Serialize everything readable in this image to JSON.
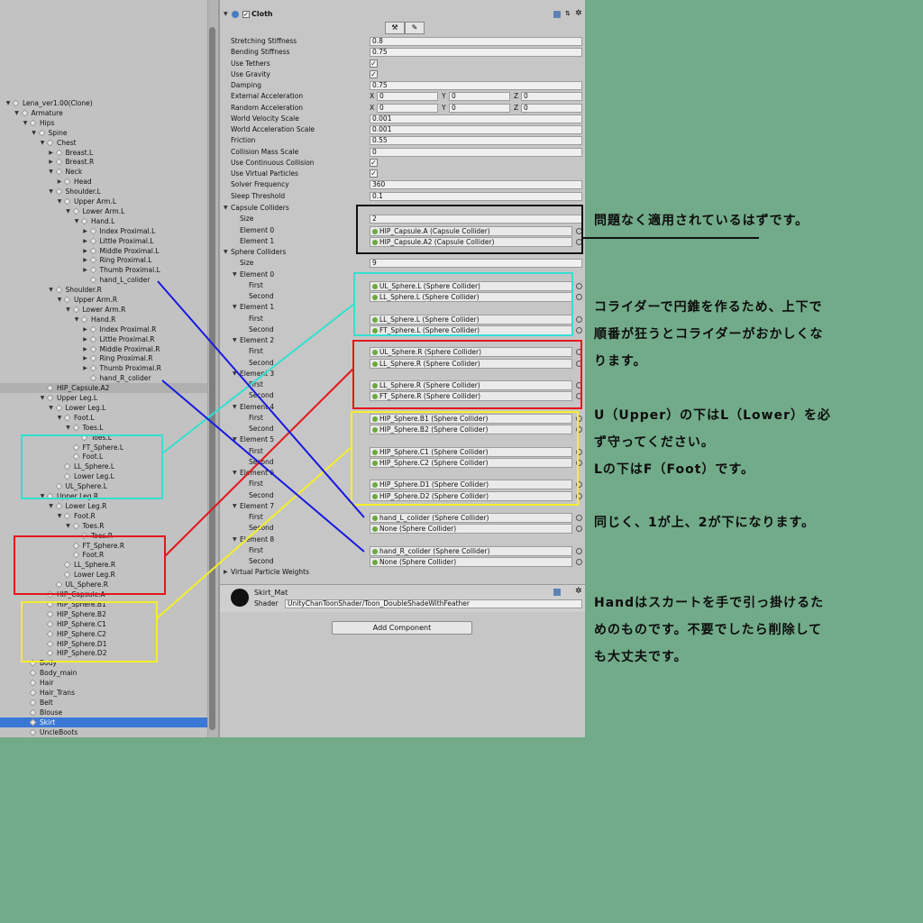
{
  "hierarchy": {
    "rows": [
      {
        "label": "Lena_ver1.00(Clone)",
        "depth": 0,
        "arrow": "down"
      },
      {
        "label": "Armature",
        "depth": 1,
        "arrow": "down"
      },
      {
        "label": "Hips",
        "depth": 2,
        "arrow": "down"
      },
      {
        "label": "Spine",
        "depth": 3,
        "arrow": "down"
      },
      {
        "label": "Chest",
        "depth": 4,
        "arrow": "down"
      },
      {
        "label": "Breast.L",
        "depth": 5,
        "arrow": "right"
      },
      {
        "label": "Breast.R",
        "depth": 5,
        "arrow": "right"
      },
      {
        "label": "Neck",
        "depth": 5,
        "arrow": "down"
      },
      {
        "label": "Head",
        "depth": 6,
        "arrow": "right"
      },
      {
        "label": "Shoulder.L",
        "depth": 5,
        "arrow": "down"
      },
      {
        "label": "Upper Arm.L",
        "depth": 6,
        "arrow": "down"
      },
      {
        "label": "Lower Arm.L",
        "depth": 7,
        "arrow": "down"
      },
      {
        "label": "Hand.L",
        "depth": 8,
        "arrow": "down"
      },
      {
        "label": "Index Proximal.L",
        "depth": 9,
        "arrow": "right"
      },
      {
        "label": "Little Proximal.L",
        "depth": 9,
        "arrow": "right"
      },
      {
        "label": "Middle Proximal.L",
        "depth": 9,
        "arrow": "right"
      },
      {
        "label": "Ring Proximal.L",
        "depth": 9,
        "arrow": "right"
      },
      {
        "label": "Thumb Proximal.L",
        "depth": 9,
        "arrow": "right"
      },
      {
        "label": "hand_L_colider",
        "depth": 9,
        "arrow": ""
      },
      {
        "label": "Shoulder.R",
        "depth": 5,
        "arrow": "down"
      },
      {
        "label": "Upper Arm.R",
        "depth": 6,
        "arrow": "down"
      },
      {
        "label": "Lower Arm.R",
        "depth": 7,
        "arrow": "down"
      },
      {
        "label": "Hand.R",
        "depth": 8,
        "arrow": "down"
      },
      {
        "label": "Index Proximal.R",
        "depth": 9,
        "arrow": "right"
      },
      {
        "label": "Little Proximal.R",
        "depth": 9,
        "arrow": "right"
      },
      {
        "label": "Middle Proximal.R",
        "depth": 9,
        "arrow": "right"
      },
      {
        "label": "Ring Proximal.R",
        "depth": 9,
        "arrow": "right"
      },
      {
        "label": "Thumb Proximal.R",
        "depth": 9,
        "arrow": "right"
      },
      {
        "label": "hand_R_colider",
        "depth": 9,
        "arrow": ""
      },
      {
        "label": "HIP_Capsule.A2",
        "depth": 4,
        "arrow": "",
        "highlight": true
      },
      {
        "label": "Upper Leg.L",
        "depth": 4,
        "arrow": "down"
      },
      {
        "label": "Lower Leg.L",
        "depth": 5,
        "arrow": "down"
      },
      {
        "label": "Foot.L",
        "depth": 6,
        "arrow": "down"
      },
      {
        "label": "Toes.L",
        "depth": 7,
        "arrow": "down"
      },
      {
        "label": "Toes.L",
        "depth": 8,
        "arrow": ""
      },
      {
        "label": "FT_Sphere.L",
        "depth": 7,
        "arrow": ""
      },
      {
        "label": "Foot.L",
        "depth": 7,
        "arrow": ""
      },
      {
        "label": "LL_Sphere.L",
        "depth": 6,
        "arrow": ""
      },
      {
        "label": "Lower Leg.L",
        "depth": 6,
        "arrow": ""
      },
      {
        "label": "UL_Sphere.L",
        "depth": 5,
        "arrow": ""
      },
      {
        "label": "Upper Leg.R",
        "depth": 4,
        "arrow": "down"
      },
      {
        "label": "Lower Leg.R",
        "depth": 5,
        "arrow": "down"
      },
      {
        "label": "Foot.R",
        "depth": 6,
        "arrow": "down"
      },
      {
        "label": "Toes.R",
        "depth": 7,
        "arrow": "down"
      },
      {
        "label": "Toes.R",
        "depth": 8,
        "arrow": ""
      },
      {
        "label": "FT_Sphere.R",
        "depth": 7,
        "arrow": ""
      },
      {
        "label": "Foot.R",
        "depth": 7,
        "arrow": ""
      },
      {
        "label": "LL_Sphere.R",
        "depth": 6,
        "arrow": ""
      },
      {
        "label": "Lower Leg.R",
        "depth": 6,
        "arrow": ""
      },
      {
        "label": "UL_Sphere.R",
        "depth": 5,
        "arrow": ""
      },
      {
        "label": "HIP_Capsule.A",
        "depth": 4,
        "arrow": ""
      },
      {
        "label": "HIP_Sphere.B1",
        "depth": 4,
        "arrow": ""
      },
      {
        "label": "HIP_Sphere.B2",
        "depth": 4,
        "arrow": ""
      },
      {
        "label": "HIP_Sphere.C1",
        "depth": 4,
        "arrow": ""
      },
      {
        "label": "HIP_Sphere.C2",
        "depth": 4,
        "arrow": ""
      },
      {
        "label": "HIP_Sphere.D1",
        "depth": 4,
        "arrow": ""
      },
      {
        "label": "HIP_Sphere.D2",
        "depth": 4,
        "arrow": ""
      },
      {
        "label": "Body",
        "depth": 2,
        "arrow": ""
      },
      {
        "label": "Body_main",
        "depth": 2,
        "arrow": ""
      },
      {
        "label": "Hair",
        "depth": 2,
        "arrow": ""
      },
      {
        "label": "Hair_Trans",
        "depth": 2,
        "arrow": ""
      },
      {
        "label": "Belt",
        "depth": 2,
        "arrow": ""
      },
      {
        "label": "Blouse",
        "depth": 2,
        "arrow": ""
      },
      {
        "label": "Skirt",
        "depth": 2,
        "arrow": "",
        "selected": true
      },
      {
        "label": "UncleBoots",
        "depth": 2,
        "arrow": ""
      }
    ]
  },
  "inspector": {
    "component_title": "Cloth",
    "properties": [
      {
        "label": "Stretching Stiffness",
        "type": "text",
        "value": "0.8"
      },
      {
        "label": "Bending Stiffness",
        "type": "text",
        "value": "0.75"
      },
      {
        "label": "Use Tethers",
        "type": "check",
        "value": "✓"
      },
      {
        "label": "Use Gravity",
        "type": "check",
        "value": "✓"
      },
      {
        "label": "Damping",
        "type": "text",
        "value": "0.75"
      },
      {
        "label": "External Acceleration",
        "type": "vec",
        "x": "0",
        "y": "0",
        "z": "0"
      },
      {
        "label": "Random Acceleration",
        "type": "vec",
        "x": "0",
        "y": "0",
        "z": "0"
      },
      {
        "label": "World Velocity Scale",
        "type": "text",
        "value": "0.001"
      },
      {
        "label": "World Acceleration Scale",
        "type": "text",
        "value": "0.001"
      },
      {
        "label": "Friction",
        "type": "text",
        "value": "0.55"
      },
      {
        "label": "Collision Mass Scale",
        "type": "text",
        "value": "0"
      },
      {
        "label": "Use Continuous Collision",
        "type": "check",
        "value": "✓"
      },
      {
        "label": "Use Virtual Particles",
        "type": "check",
        "value": "✓"
      },
      {
        "label": "Solver Frequency",
        "type": "text",
        "value": "360"
      },
      {
        "label": "Sleep Threshold",
        "type": "text",
        "value": "0.1"
      }
    ],
    "vec_labels": {
      "x": "X",
      "y": "Y",
      "z": "Z"
    },
    "capsule": {
      "header": "Capsule Colliders",
      "size_label": "Size",
      "size": "2",
      "elements": [
        {
          "label": "Element 0",
          "value": "HIP_Capsule.A (Capsule Collider)"
        },
        {
          "label": "Element 1",
          "value": "HIP_Capsule.A2 (Capsule Collider)"
        }
      ]
    },
    "sphere": {
      "header": "Sphere Colliders",
      "size_label": "Size",
      "size": "9",
      "first_label": "First",
      "second_label": "Second",
      "elements": [
        {
          "label": "Element 0",
          "first": "UL_Sphere.L (Sphere Collider)",
          "second": "LL_Sphere.L (Sphere Collider)"
        },
        {
          "label": "Element 1",
          "first": "LL_Sphere.L (Sphere Collider)",
          "second": "FT_Sphere.L (Sphere Collider)"
        },
        {
          "label": "Element 2",
          "first": "UL_Sphere.R (Sphere Collider)",
          "second": "LL_Sphere.R (Sphere Collider)"
        },
        {
          "label": "Element 3",
          "first": "LL_Sphere.R (Sphere Collider)",
          "second": "FT_Sphere.R (Sphere Collider)"
        },
        {
          "label": "Element 4",
          "first": "HIP_Sphere.B1 (Sphere Collider)",
          "second": "HIP_Sphere.B2 (Sphere Collider)"
        },
        {
          "label": "Element 5",
          "first": "HIP_Sphere.C1 (Sphere Collider)",
          "second": "HIP_Sphere.C2 (Sphere Collider)"
        },
        {
          "label": "Element 6",
          "first": "HIP_Sphere.D1 (Sphere Collider)",
          "second": "HIP_Sphere.D2 (Sphere Collider)"
        },
        {
          "label": "Element 7",
          "first": "hand_L_colider (Sphere Collider)",
          "second": "None (Sphere Collider)"
        },
        {
          "label": "Element 8",
          "first": "hand_R_colider (Sphere Collider)",
          "second": "None (Sphere Collider)"
        }
      ]
    },
    "virtual_particle_weights": "Virtual Particle Weights",
    "material": {
      "name": "Skirt_Mat",
      "shader_label": "Shader",
      "shader": "UnityChanToonShader/Toon_DoubleShadeWithFeather"
    },
    "add_component": "Add Component"
  },
  "notes": [
    [
      "問題なく適用されているはずです。"
    ],
    [
      "コライダーで円錐を作るため、上下で",
      "順番が狂うとコライダーがおかしくな",
      "ります。"
    ],
    [
      "U（Upper）の下はL（Lower）を必",
      "ず守ってください。",
      "Lの下はF（Foot）です。"
    ],
    [
      "同じく、1が上、2が下になります。"
    ],
    [
      "Handはスカートを手で引っ掛けるた",
      "めのものです。不要でしたら削除して",
      "も大丈夫です。"
    ]
  ],
  "colors": {
    "background": "#72ab8a",
    "black_box": "#111111",
    "cyan_box": "#34e0cf",
    "red_box": "#e4161b",
    "yellow_box": "#f3ee2c",
    "blue_line": "#1818e0",
    "selection": "#3a78d8"
  }
}
